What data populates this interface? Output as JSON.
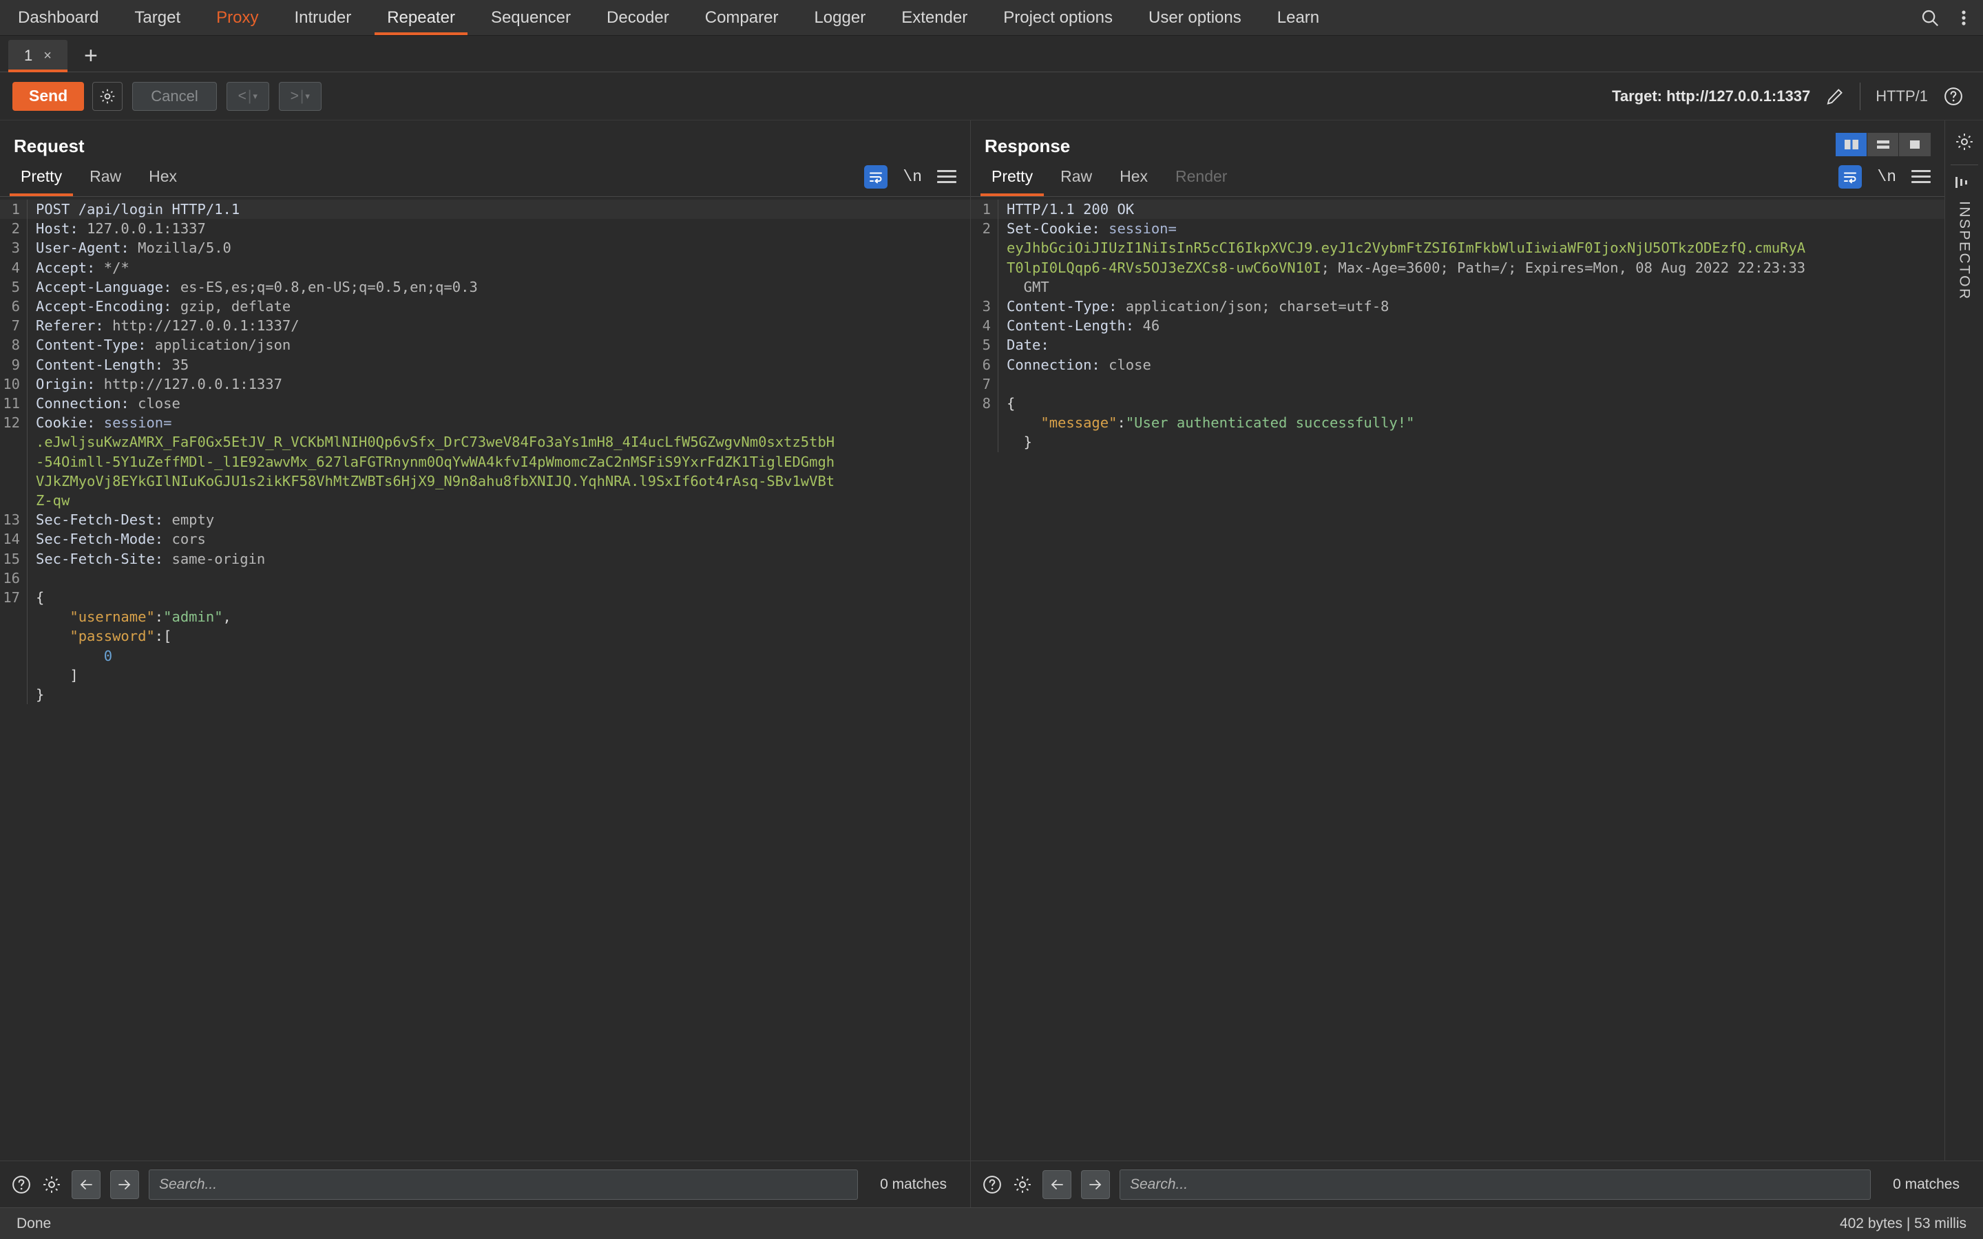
{
  "topnav": {
    "tabs": [
      {
        "label": "Dashboard",
        "state": "normal"
      },
      {
        "label": "Target",
        "state": "normal"
      },
      {
        "label": "Proxy",
        "state": "accent"
      },
      {
        "label": "Intruder",
        "state": "normal"
      },
      {
        "label": "Repeater",
        "state": "active"
      },
      {
        "label": "Sequencer",
        "state": "normal"
      },
      {
        "label": "Decoder",
        "state": "normal"
      },
      {
        "label": "Comparer",
        "state": "normal"
      },
      {
        "label": "Logger",
        "state": "normal"
      },
      {
        "label": "Extender",
        "state": "normal"
      },
      {
        "label": "Project options",
        "state": "normal"
      },
      {
        "label": "User options",
        "state": "normal"
      },
      {
        "label": "Learn",
        "state": "normal"
      }
    ],
    "search_icon": "search-icon",
    "menu_icon": "kebab-menu-icon"
  },
  "tabstrip": {
    "tab_label": "1",
    "close_label": "×",
    "add_label": "+"
  },
  "actionbar": {
    "send_label": "Send",
    "settings_icon": "gear-icon",
    "cancel_label": "Cancel",
    "prev_label": "<",
    "next_label": ">",
    "separator": "|",
    "caret": "▾",
    "target_label": "Target: http://127.0.0.1:1337",
    "edit_icon": "pencil-icon",
    "http_version": "HTTP/1",
    "help_icon": "help-circle-icon"
  },
  "request": {
    "title": "Request",
    "tabs": [
      {
        "label": "Pretty",
        "state": "active"
      },
      {
        "label": "Raw",
        "state": "normal"
      },
      {
        "label": "Hex",
        "state": "normal"
      }
    ],
    "wrap_icon": "word-wrap-icon",
    "newline_label": "\\n",
    "menu_icon": "hamburger-menu-icon",
    "lines": [
      {
        "n": "1",
        "segs": [
          {
            "t": "POST /api/login HTTP/1.1",
            "c": "hdr-name"
          }
        ]
      },
      {
        "n": "2",
        "segs": [
          {
            "t": "Host: ",
            "c": "hdr-name"
          },
          {
            "t": "127.0.0.1:1337",
            "c": "hdr-val"
          }
        ]
      },
      {
        "n": "3",
        "segs": [
          {
            "t": "User-Agent: ",
            "c": "hdr-name"
          },
          {
            "t": "Mozilla/5.0",
            "c": "hdr-val"
          }
        ]
      },
      {
        "n": "4",
        "segs": [
          {
            "t": "Accept: ",
            "c": "hdr-name"
          },
          {
            "t": "*/*",
            "c": "hdr-val"
          }
        ]
      },
      {
        "n": "5",
        "segs": [
          {
            "t": "Accept-Language: ",
            "c": "hdr-name"
          },
          {
            "t": "es-ES,es;q=0.8,en-US;q=0.5,en;q=0.3",
            "c": "hdr-val"
          }
        ]
      },
      {
        "n": "6",
        "segs": [
          {
            "t": "Accept-Encoding: ",
            "c": "hdr-name"
          },
          {
            "t": "gzip, deflate",
            "c": "hdr-val"
          }
        ]
      },
      {
        "n": "7",
        "segs": [
          {
            "t": "Referer: ",
            "c": "hdr-name"
          },
          {
            "t": "http://127.0.0.1:1337/",
            "c": "hdr-val"
          }
        ]
      },
      {
        "n": "8",
        "segs": [
          {
            "t": "Content-Type: ",
            "c": "hdr-name"
          },
          {
            "t": "application/json",
            "c": "hdr-val"
          }
        ]
      },
      {
        "n": "9",
        "segs": [
          {
            "t": "Content-Length: ",
            "c": "hdr-name"
          },
          {
            "t": "35",
            "c": "hdr-val"
          }
        ]
      },
      {
        "n": "10",
        "segs": [
          {
            "t": "Origin: ",
            "c": "hdr-name"
          },
          {
            "t": "http://127.0.0.1:1337",
            "c": "hdr-val"
          }
        ]
      },
      {
        "n": "11",
        "segs": [
          {
            "t": "Connection: ",
            "c": "hdr-name"
          },
          {
            "t": "close",
            "c": "hdr-val"
          }
        ]
      },
      {
        "n": "12",
        "segs": [
          {
            "t": "Cookie: ",
            "c": "hdr-name"
          },
          {
            "t": "session=",
            "c": "tok-ck"
          }
        ]
      },
      {
        "n": "",
        "segs": [
          {
            "t": ".eJwljsuKwzAMRX_FaF0Gx5EtJV_R_VCKbMlNIH0Qp6vSfx_DrC73weV84Fo3aYs1mH8_4I4ucLfW5GZwgvNm0sxtz5tbH",
            "c": "tok-green"
          }
        ]
      },
      {
        "n": "",
        "segs": [
          {
            "t": "-54Oimll-5Y1uZeffMDl-_l1E92awvMx_627laFGTRnynm0OqYwWA4kfvI4pWmomcZaC2nMSFiS9YxrFdZK1TiglEDGmgh",
            "c": "tok-green"
          }
        ]
      },
      {
        "n": "",
        "segs": [
          {
            "t": "VJkZMyoVj8EYkGIlNIuKoGJU1s2ikKF58VhMtZWBTs6HjX9_N9n8ahu8fbXNIJQ.YqhNRA.l9SxIf6ot4rAsq-SBv1wVBt",
            "c": "tok-green"
          }
        ]
      },
      {
        "n": "",
        "segs": [
          {
            "t": "Z-qw",
            "c": "tok-green"
          }
        ]
      },
      {
        "n": "13",
        "segs": [
          {
            "t": "Sec-Fetch-Dest: ",
            "c": "hdr-name"
          },
          {
            "t": "empty",
            "c": "hdr-val"
          }
        ]
      },
      {
        "n": "14",
        "segs": [
          {
            "t": "Sec-Fetch-Mode: ",
            "c": "hdr-name"
          },
          {
            "t": "cors",
            "c": "hdr-val"
          }
        ]
      },
      {
        "n": "15",
        "segs": [
          {
            "t": "Sec-Fetch-Site: ",
            "c": "hdr-name"
          },
          {
            "t": "same-origin",
            "c": "hdr-val"
          }
        ]
      },
      {
        "n": "16",
        "segs": [
          {
            "t": "",
            "c": "hdr-val"
          }
        ]
      },
      {
        "n": "17",
        "segs": [
          {
            "t": "{",
            "c": "tok-brace"
          }
        ]
      },
      {
        "n": "",
        "segs": [
          {
            "t": "    ",
            "c": "tok-brace"
          },
          {
            "t": "\"username\"",
            "c": "tok-key"
          },
          {
            "t": ":",
            "c": "tok-brace"
          },
          {
            "t": "\"admin\"",
            "c": "tok-str"
          },
          {
            "t": ",",
            "c": "tok-brace"
          }
        ]
      },
      {
        "n": "",
        "segs": [
          {
            "t": "    ",
            "c": "tok-brace"
          },
          {
            "t": "\"password\"",
            "c": "tok-key"
          },
          {
            "t": ":[",
            "c": "tok-brace"
          }
        ]
      },
      {
        "n": "",
        "segs": [
          {
            "t": "        ",
            "c": "tok-brace"
          },
          {
            "t": "0",
            "c": "tok-num"
          }
        ]
      },
      {
        "n": "",
        "segs": [
          {
            "t": "    ]",
            "c": "tok-brace"
          }
        ]
      },
      {
        "n": "",
        "segs": [
          {
            "t": "}",
            "c": "tok-brace"
          }
        ]
      }
    ],
    "search_placeholder": "Search...",
    "matches_label": "0 matches",
    "help_icon": "help-circle-icon",
    "settings_icon": "gear-icon",
    "prev_icon": "arrow-left-icon",
    "next_icon": "arrow-right-icon"
  },
  "response": {
    "title": "Response",
    "tabs": [
      {
        "label": "Pretty",
        "state": "active"
      },
      {
        "label": "Raw",
        "state": "normal"
      },
      {
        "label": "Hex",
        "state": "normal"
      },
      {
        "label": "Render",
        "state": "disabled"
      }
    ],
    "wrap_icon": "word-wrap-icon",
    "newline_label": "\\n",
    "menu_icon": "hamburger-menu-icon",
    "layout_toggles": [
      {
        "name": "split-vertical",
        "state": "active"
      },
      {
        "name": "split-horizontal",
        "state": "normal"
      },
      {
        "name": "single-pane",
        "state": "normal"
      }
    ],
    "lines": [
      {
        "n": "1",
        "segs": [
          {
            "t": "HTTP/1.1 200 OK",
            "c": "hdr-name"
          }
        ]
      },
      {
        "n": "2",
        "segs": [
          {
            "t": "Set-Cookie: ",
            "c": "hdr-name"
          },
          {
            "t": "session=",
            "c": "tok-ck"
          }
        ]
      },
      {
        "n": "",
        "segs": [
          {
            "t": "eyJhbGciOiJIUzI1NiIsInR5cCI6IkpXVCJ9.eyJ1c2VybmFtZSI6ImFkbWluIiwiaWF0IjoxNjU5OTkzODEzfQ.cmuRyA",
            "c": "tok-green"
          }
        ]
      },
      {
        "n": "",
        "segs": [
          {
            "t": "T0lpI0LQqp6-4RVs5OJ3eZXCs8-uwC6oVN10I",
            "c": "tok-green"
          },
          {
            "t": "; Max-Age=3600; Path=/; Expires=Mon, 08 Aug 2022 22:23:33",
            "c": "hdr-val"
          }
        ]
      },
      {
        "n": "",
        "segs": [
          {
            "t": "  GMT",
            "c": "hdr-val"
          }
        ]
      },
      {
        "n": "3",
        "segs": [
          {
            "t": "Content-Type: ",
            "c": "hdr-name"
          },
          {
            "t": "application/json; charset=utf-8",
            "c": "hdr-val"
          }
        ]
      },
      {
        "n": "4",
        "segs": [
          {
            "t": "Content-Length: ",
            "c": "hdr-name"
          },
          {
            "t": "46",
            "c": "hdr-val"
          }
        ]
      },
      {
        "n": "5",
        "segs": [
          {
            "t": "Date: ",
            "c": "hdr-name"
          }
        ]
      },
      {
        "n": "6",
        "segs": [
          {
            "t": "Connection: ",
            "c": "hdr-name"
          },
          {
            "t": "close",
            "c": "hdr-val"
          }
        ]
      },
      {
        "n": "7",
        "segs": [
          {
            "t": "",
            "c": "hdr-val"
          }
        ]
      },
      {
        "n": "8",
        "segs": [
          {
            "t": "{",
            "c": "tok-brace"
          }
        ]
      },
      {
        "n": "",
        "segs": [
          {
            "t": "    ",
            "c": "tok-brace"
          },
          {
            "t": "\"message\"",
            "c": "tok-key"
          },
          {
            "t": ":",
            "c": "tok-brace"
          },
          {
            "t": "\"User authenticated successfully!\"",
            "c": "tok-str"
          }
        ]
      },
      {
        "n": "",
        "segs": [
          {
            "t": "  }",
            "c": "tok-brace"
          }
        ]
      }
    ],
    "search_placeholder": "Search...",
    "matches_label": "0 matches",
    "help_icon": "help-circle-icon",
    "settings_icon": "gear-icon",
    "prev_icon": "arrow-left-icon",
    "next_icon": "arrow-right-icon"
  },
  "inspector": {
    "gear_icon": "gear-icon",
    "collapse_icon": "collapse-panel-icon",
    "label": "INSPECTOR"
  },
  "statusbar": {
    "left_text": "Done",
    "right_text": "402 bytes | 53 millis"
  },
  "colors": {
    "accent_orange": "#e8622a",
    "accent_blue": "#2f6fce",
    "background": "#2b2b2b",
    "panel": "#333333",
    "string_green": "#a5c261",
    "json_key": "#d9a24a"
  }
}
